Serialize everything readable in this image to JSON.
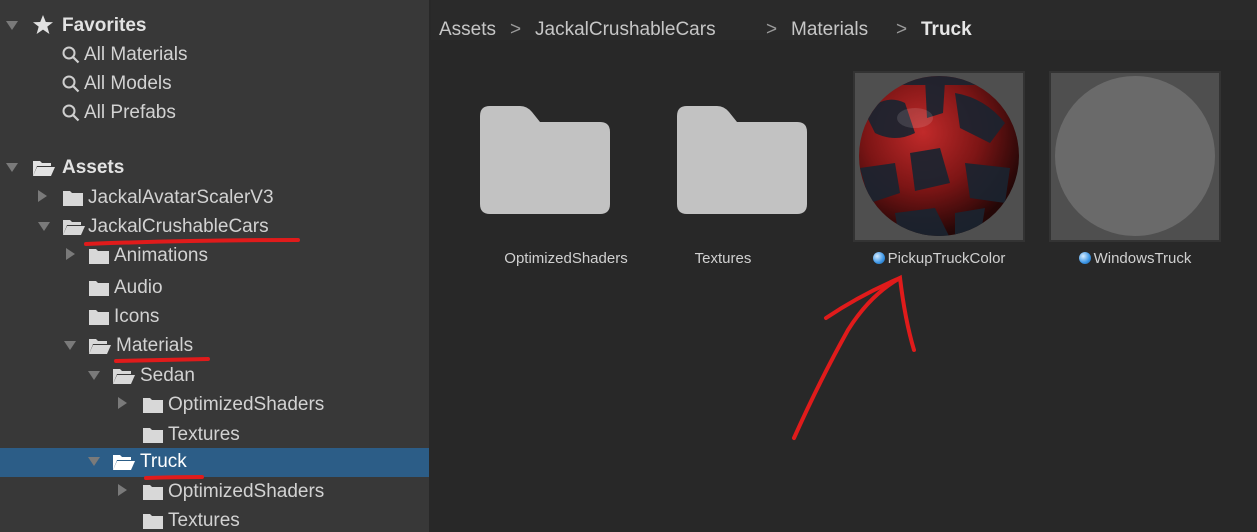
{
  "tree": {
    "favorites_label": "Favorites",
    "favorites": [
      "All Materials",
      "All Models",
      "All Prefabs"
    ],
    "assets_label": "Assets",
    "items": [
      {
        "label": "JackalAvatarScalerV3"
      },
      {
        "label": "JackalCrushableCars"
      },
      {
        "label": "Animations"
      },
      {
        "label": "Audio"
      },
      {
        "label": "Icons"
      },
      {
        "label": "Materials"
      },
      {
        "label": "Sedan"
      },
      {
        "label": "OptimizedShaders"
      },
      {
        "label": "Textures"
      },
      {
        "label": "Truck"
      },
      {
        "label": "OptimizedShaders"
      },
      {
        "label": "Textures"
      }
    ]
  },
  "breadcrumb": {
    "segments": [
      "Assets",
      "JackalCrushableCars",
      "Materials",
      "Truck"
    ],
    "separator": ">"
  },
  "grid": {
    "items": [
      {
        "label": "OptimizedShaders",
        "kind": "folder"
      },
      {
        "label": "Textures",
        "kind": "folder"
      },
      {
        "label": "PickupTruckColor",
        "kind": "material-red"
      },
      {
        "label": "WindowsTruck",
        "kind": "material-grey"
      }
    ]
  },
  "colors": {
    "tree_bg": "#383838",
    "content_bg": "#282828",
    "selection": "#2c5d87",
    "annotation": "#e01b1b"
  }
}
